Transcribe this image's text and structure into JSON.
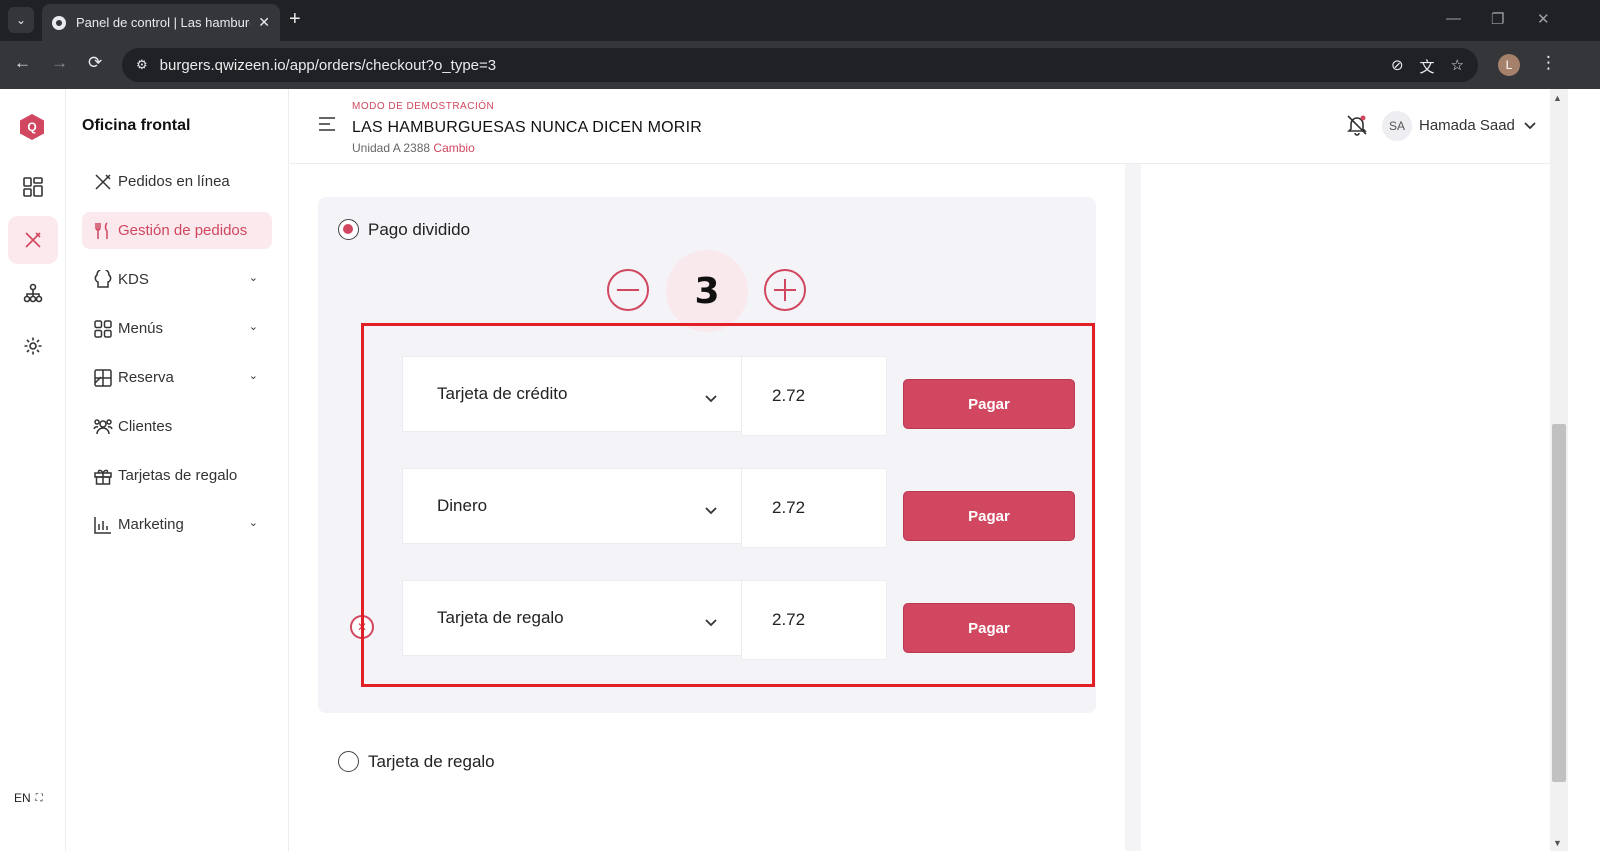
{
  "browser": {
    "tab_title": "Panel de control | Las hamburg",
    "tab_close": "✕",
    "new_tab": "+",
    "url": "burgers.qwizeen.io/app/orders/checkout?o_type=3",
    "profile_initial": "L"
  },
  "rail": {
    "logo": "Q",
    "lang": "EN"
  },
  "sidebar": {
    "title": "Oficina frontal",
    "items": [
      {
        "label": "Pedidos en línea",
        "icon": "fork-knife-icon",
        "active": false,
        "expandable": false
      },
      {
        "label": "Gestión de pedidos",
        "icon": "utensils-icon",
        "active": true,
        "expandable": false
      },
      {
        "label": "KDS",
        "icon": "chef-hat-icon",
        "active": false,
        "expandable": true
      },
      {
        "label": "Menús",
        "icon": "grid-icon",
        "active": false,
        "expandable": true
      },
      {
        "label": "Reserva",
        "icon": "table-icon",
        "active": false,
        "expandable": true
      },
      {
        "label": "Clientes",
        "icon": "users-icon",
        "active": false,
        "expandable": false
      },
      {
        "label": "Tarjetas de regalo",
        "icon": "gift-icon",
        "active": false,
        "expandable": false
      },
      {
        "label": "Marketing",
        "icon": "bar-chart-icon",
        "active": false,
        "expandable": true
      }
    ]
  },
  "header": {
    "demo_mode": "MODO DE DEMOSTRACIÓN",
    "restaurant": "LAS HAMBURGUESAS NUNCA DICEN MORIR",
    "unit": "Unidad A 2388",
    "change": "Cambio",
    "avatar_initials": "SA",
    "user_name": "Hamada Saad"
  },
  "payment": {
    "split_label": "Pago dividido",
    "split_count": "3",
    "rows": [
      {
        "method": "Tarjeta de crédito",
        "amount": "2.72",
        "pay_label": "Pagar"
      },
      {
        "method": "Dinero",
        "amount": "2.72",
        "pay_label": "Pagar"
      },
      {
        "method": "Tarjeta de regalo",
        "amount": "2.72",
        "pay_label": "Pagar"
      }
    ],
    "gift_option_label": "Tarjeta de regalo"
  },
  "colors": {
    "accent": "#d0475f",
    "highlight": "#e01f26"
  }
}
